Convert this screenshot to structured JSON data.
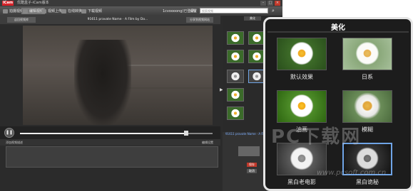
{
  "window": {
    "logo": "ICam",
    "title": "优酷盒子-iCam版本",
    "controls": [
      "–",
      "□",
      "×"
    ]
  },
  "toolbar": {
    "items": [
      "拍摄视频",
      "编辑视频",
      "视频上传",
      "在线转换",
      "下载视频"
    ],
    "account": "1cvoooong(已登录)",
    "settings": "设置",
    "search_placeholder": "搜索视频",
    "search_icon": "search-icon"
  },
  "subbar": {
    "back_label": "返回视频库",
    "video_title": "91611 pravate Name · A Film by Do...",
    "share_label": "分享到视频网站"
  },
  "player": {
    "play_icon": "play-icon",
    "progress": 0.86
  },
  "comment": {
    "label": "添加视频描述",
    "right_label": "编辑设置"
  },
  "right_panel": {
    "tab_label": "美化",
    "thumb_labels": [
      "默认效果",
      "日系",
      "油画",
      "模糊",
      "黑白老电影",
      "黑白诡秘"
    ],
    "bottom_title": "91611 pravate Name · A Film...",
    "save_label": "保存",
    "cancel_label": "取消"
  },
  "popup": {
    "title": "美化",
    "effects": [
      {
        "label": "默认效果",
        "style": "default"
      },
      {
        "label": "日系",
        "style": "japan"
      },
      {
        "label": "油画",
        "style": "paint"
      },
      {
        "label": "模糊",
        "style": "blur"
      },
      {
        "label": "黑白老电影",
        "style": "bw"
      },
      {
        "label": "黑白诡秘",
        "style": "bwmyst"
      }
    ],
    "selected": "黑白诡秘"
  },
  "watermark": {
    "text": "PC下载网",
    "url": "www.pcsoft.com.cn"
  }
}
